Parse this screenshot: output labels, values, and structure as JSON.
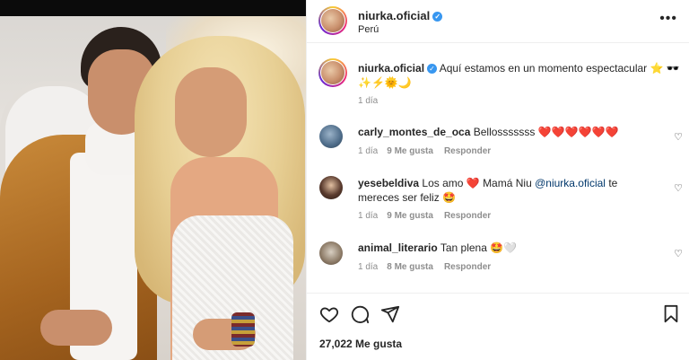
{
  "post": {
    "username": "niurka.oficial",
    "location": "Perú",
    "caption": "Aquí estamos en un momento espectacular ⭐ 🕶️✨⚡🌞🌙",
    "caption_time": "1 día",
    "likes": "27,022 Me gusta"
  },
  "comments": [
    {
      "user": "carly_montes_de_oca",
      "text": "Bellosssssss",
      "hearts": "❤️❤️❤️❤️❤️❤️",
      "time": "1 día",
      "likes": "9 Me gusta",
      "reply": "Responder"
    },
    {
      "user": "yesebeldiva",
      "text": "Los amo",
      "text2": "Mamá Niu",
      "mention": "@niurka.oficial",
      "text3": "te mereces ser feliz",
      "emoji": "🤩",
      "time": "1 día",
      "likes": "9 Me gusta",
      "reply": "Responder"
    },
    {
      "user": "animal_literario",
      "text": "Tan plena",
      "emoji": "🤩🤍",
      "time": "1 día",
      "likes": "8 Me gusta",
      "reply": "Responder"
    }
  ],
  "icons": {
    "heart": "heart-icon",
    "comment": "comment-icon",
    "share": "share-icon",
    "bookmark": "bookmark-icon",
    "more": "more-options-icon",
    "verified": "verified-badge-icon"
  },
  "colors": {
    "verified": "#3897f0",
    "heart_red": "#ed4956",
    "mention": "#00376b"
  }
}
